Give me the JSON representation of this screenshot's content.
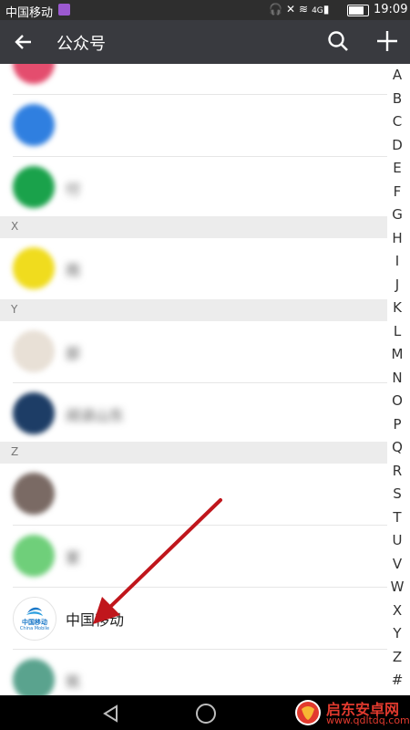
{
  "status_bar": {
    "carrier": "中国移动",
    "network": "4G",
    "battery_level": 0.8,
    "time": "19:09"
  },
  "app_bar": {
    "title": "公众号",
    "back_icon": "arrow-left-icon",
    "search_icon": "search-icon",
    "add_icon": "plus-icon"
  },
  "list": {
    "sections": [
      {
        "letter": "",
        "rows": [
          {
            "name": "",
            "avatar_color": "#e44d6e",
            "blurred": true
          },
          {
            "name": "",
            "avatar_color": "#2f7fe0",
            "blurred": true
          },
          {
            "name": "付",
            "avatar_color": "#1aa24b",
            "blurred": true
          }
        ]
      },
      {
        "letter": "X",
        "rows": [
          {
            "name": "雨",
            "avatar_color": "#f0dc1e",
            "blurred": true
          }
        ]
      },
      {
        "letter": "Y",
        "rows": [
          {
            "name": "部",
            "avatar_color": "#e8e0d6",
            "blurred": true
          },
          {
            "name": "阅读山东",
            "avatar_color": "#1d3d66",
            "blurred": true
          }
        ]
      },
      {
        "letter": "Z",
        "rows": [
          {
            "name": "",
            "avatar_color": "#7a6a64",
            "blurred": true
          },
          {
            "name": "家",
            "avatar_color": "#6fcf7a",
            "blurred": true
          },
          {
            "name": "中国移动",
            "avatar_color": "#ffffff",
            "blurred": false,
            "avatar_text": "中国移动",
            "avatar_subtext": "China Mobile"
          },
          {
            "name": "筑",
            "avatar_color": "#5aa38e",
            "blurred": true
          }
        ]
      }
    ]
  },
  "index_letters": [
    "A",
    "B",
    "C",
    "D",
    "E",
    "F",
    "G",
    "H",
    "I",
    "J",
    "K",
    "L",
    "M",
    "N",
    "O",
    "P",
    "Q",
    "R",
    "S",
    "T",
    "U",
    "V",
    "W",
    "X",
    "Y",
    "Z",
    "#"
  ],
  "watermark": {
    "main": "启东安卓网",
    "sub": "www.qdltdq.com"
  },
  "colors": {
    "app_bar": "#393a3f",
    "status_bar": "#2e2e2e",
    "section_bg": "#ececec",
    "arrow": "#c0161c",
    "brand_blue": "#1a78c8"
  }
}
